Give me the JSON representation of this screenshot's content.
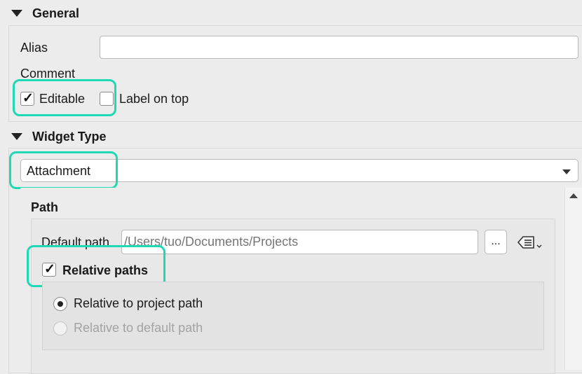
{
  "general": {
    "header": "General",
    "alias_label": "Alias",
    "alias_value": "",
    "comment_label": "Comment",
    "editable_label": "Editable",
    "editable_checked": true,
    "label_on_top_label": "Label on top",
    "label_on_top_checked": false
  },
  "widget_type": {
    "header": "Widget Type",
    "selected": "Attachment"
  },
  "path": {
    "header": "Path",
    "default_path_label": "Default path",
    "default_path_placeholder": "/Users/tuo/Documents/Projects",
    "browse_label": "...",
    "relative_paths_label": "Relative paths",
    "relative_paths_checked": true,
    "radio_project_label": "Relative to project path",
    "radio_project_selected": true,
    "radio_default_label": "Relative to default path",
    "radio_default_selected": false
  },
  "colors": {
    "highlight": "#1fd9b4"
  },
  "icons": {
    "checkmark": "checkmark-icon",
    "data_defined": "data-defined-override-icon"
  }
}
